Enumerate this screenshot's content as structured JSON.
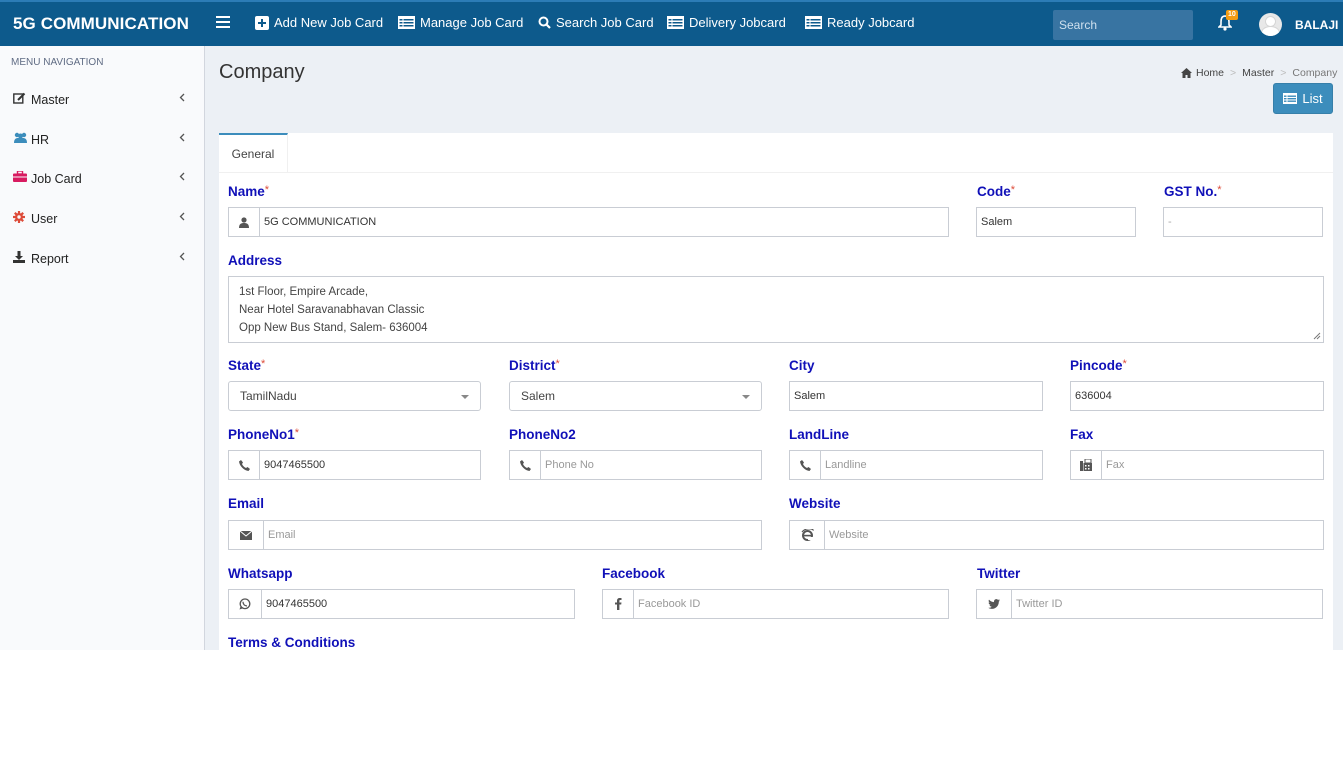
{
  "header": {
    "brand": "5G COMMUNICATION",
    "nav": [
      {
        "label": "Add New Job Card",
        "icon": "plus-square-icon"
      },
      {
        "label": "Manage Job Card",
        "icon": "list-icon"
      },
      {
        "label": "Search Job Card",
        "icon": "search-icon"
      },
      {
        "label": "Delivery Jobcard",
        "icon": "list-icon"
      },
      {
        "label": "Ready Jobcard",
        "icon": "list-icon"
      }
    ],
    "search_placeholder": "Search",
    "notification_count": "10",
    "user_name": "BALAJI",
    "bar_color": "#0d5a8c"
  },
  "sidebar": {
    "header": "MENU NAVIGATION",
    "items": [
      {
        "label": "Master",
        "icon": "edit-icon"
      },
      {
        "label": "HR",
        "icon": "users-icon"
      },
      {
        "label": "Job Card",
        "icon": "briefcase-icon"
      },
      {
        "label": "User",
        "icon": "gear-icon"
      },
      {
        "label": "Report",
        "icon": "download-icon"
      }
    ]
  },
  "page": {
    "title": "Company",
    "breadcrumb": [
      "Home",
      "Master",
      "Company"
    ],
    "list_button": "List",
    "tab": "General"
  },
  "form": {
    "name": {
      "label": "Name",
      "required": "*",
      "value": "5G COMMUNICATION",
      "icon": "user-icon"
    },
    "code": {
      "label": "Code",
      "required": "*",
      "value": "Salem"
    },
    "gst": {
      "label": "GST No.",
      "required": "*",
      "value": "-"
    },
    "address": {
      "label": "Address",
      "lines": [
        "1st Floor, Empire Arcade,",
        "Near Hotel Saravanabhavan Classic",
        "Opp New Bus Stand, Salem- 636004"
      ]
    },
    "state": {
      "label": "State",
      "required": "*",
      "value": "TamilNadu"
    },
    "district": {
      "label": "District",
      "required": "*",
      "value": "Salem"
    },
    "city": {
      "label": "City",
      "value": "Salem"
    },
    "pincode": {
      "label": "Pincode",
      "required": "*",
      "value": "636004"
    },
    "phone1": {
      "label": "PhoneNo1",
      "required": "*",
      "value": "9047465500",
      "icon": "phone-icon"
    },
    "phone2": {
      "label": "PhoneNo2",
      "placeholder": "Phone No",
      "icon": "phone-icon"
    },
    "landline": {
      "label": "LandLine",
      "placeholder": "Landline",
      "icon": "phone-icon"
    },
    "fax": {
      "label": "Fax",
      "placeholder": "Fax",
      "icon": "fax-icon"
    },
    "email": {
      "label": "Email",
      "placeholder": "Email",
      "icon": "envelope-icon"
    },
    "website": {
      "label": "Website",
      "placeholder": "Website",
      "icon": "internet-explorer-icon"
    },
    "whatsapp": {
      "label": "Whatsapp",
      "value": "9047465500",
      "icon": "whatsapp-icon"
    },
    "facebook": {
      "label": "Facebook",
      "placeholder": "Facebook ID",
      "icon": "facebook-icon"
    },
    "twitter": {
      "label": "Twitter",
      "placeholder": "Twitter ID",
      "icon": "twitter-icon"
    },
    "terms": {
      "label": "Terms & Conditions"
    }
  }
}
